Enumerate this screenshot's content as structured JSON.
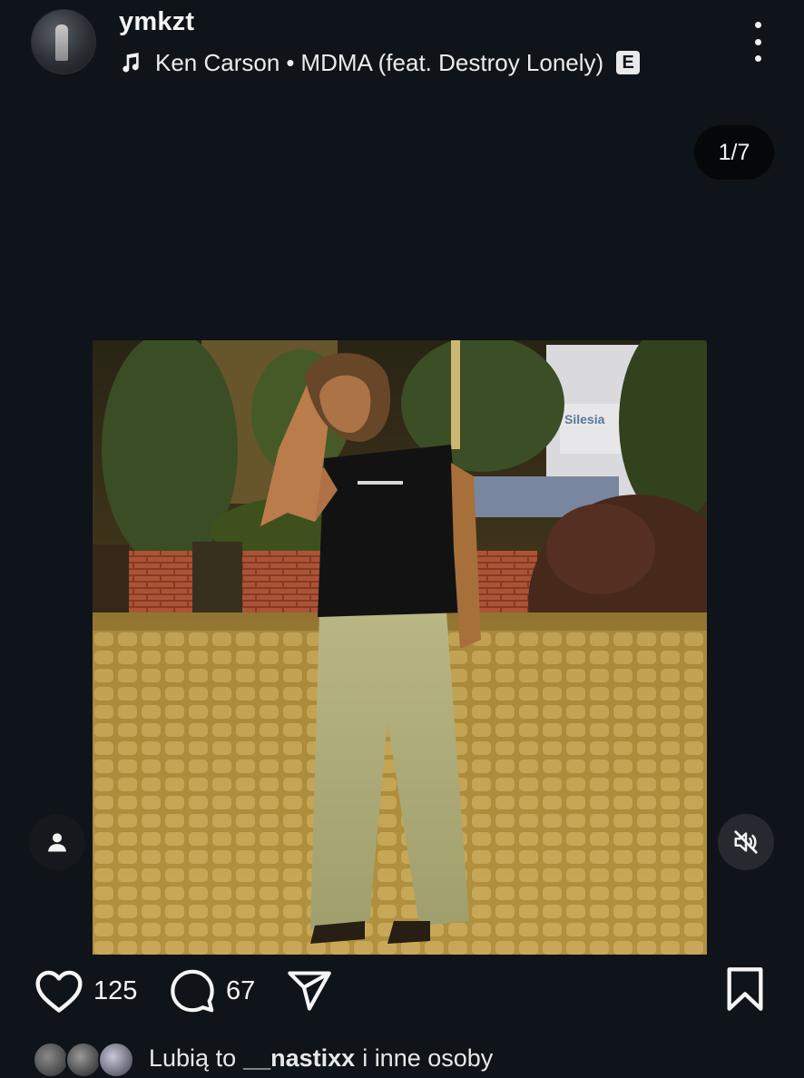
{
  "post": {
    "username": "ymkzt",
    "music": {
      "artist": "Ken Carson",
      "separator": "•",
      "track": "MDMA (feat. Destroy Lonely)",
      "explicit_badge": "E"
    },
    "carousel_counter": "1/7"
  },
  "actions": {
    "likes_count": "125",
    "comments_count": "67"
  },
  "liked_by": {
    "prefix": "Lubią to",
    "name": "__nastixx",
    "suffix": "i inne osoby"
  },
  "icons": {
    "more": "more-vertical-icon",
    "music": "music-note-icon",
    "person_tag": "person-icon",
    "mute": "speaker-muted-icon",
    "like": "heart-icon",
    "comment": "comment-bubble-icon",
    "share": "paper-plane-icon",
    "save": "bookmark-icon"
  },
  "colors": {
    "background": "#0f131a",
    "text": "#f5f5f5",
    "photo_tone": "#c9a650"
  }
}
